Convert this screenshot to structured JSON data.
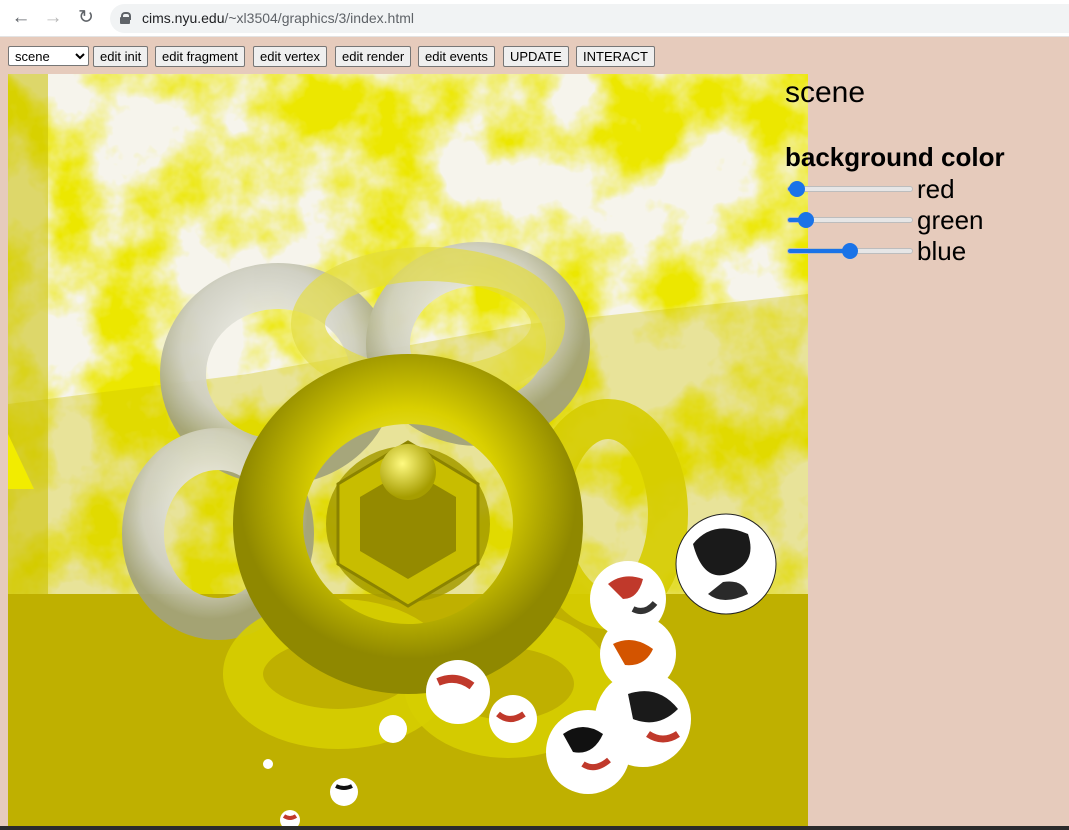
{
  "browser": {
    "url_host": "cims.nyu.edu",
    "url_path": "/~xl3504/graphics/3/index.html"
  },
  "toolbar": {
    "scene_select": {
      "selected": "scene",
      "options": [
        "scene"
      ]
    },
    "buttons": [
      {
        "label": "edit init"
      },
      {
        "label": "edit fragment"
      },
      {
        "label": "edit vertex"
      },
      {
        "label": "edit render"
      },
      {
        "label": "edit events"
      },
      {
        "label": "UPDATE"
      },
      {
        "label": "INTERACT"
      }
    ]
  },
  "panel": {
    "title": "scene",
    "subtitle": "background color",
    "sliders": [
      {
        "label": "red",
        "value": 0.08
      },
      {
        "label": "green",
        "value": 0.15
      },
      {
        "label": "blue",
        "value": 0.5
      }
    ]
  },
  "colors": {
    "accent": "#1a73e8",
    "page_bg": "#e6cbbc",
    "floor": "#bfb000",
    "torus": "#e8e000"
  },
  "icons": {
    "back": "arrow-left-icon",
    "forward": "arrow-right-icon",
    "reload": "reload-icon",
    "lock": "lock-icon"
  }
}
